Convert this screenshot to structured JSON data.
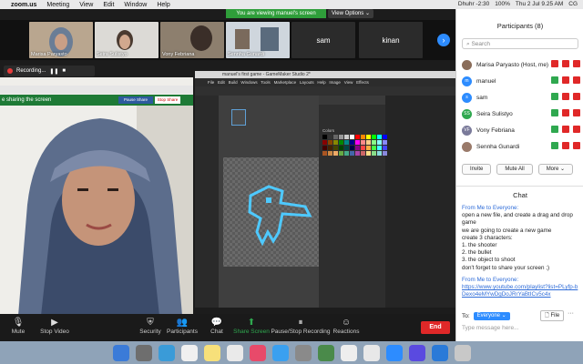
{
  "menubar": {
    "app": "zoom.us",
    "items": [
      "Meeting",
      "View",
      "Edit",
      "Window",
      "Help"
    ],
    "status": [
      "Dhuhr -2:30",
      "100%",
      "Thu 2 Jul 9.25 AM",
      "CG"
    ]
  },
  "meeting": {
    "viewing_banner": "You are viewing manuel's screen",
    "view_options": "View Options ⌄",
    "recording_label": "Recording...",
    "sharing_label": "e sharing the screen",
    "pause_share": "Pause Share",
    "stop_share": "Stop Share",
    "thumbnails": [
      {
        "name": "Marisa Paryasto",
        "kind": "video"
      },
      {
        "name": "Seira Sulistyo",
        "kind": "video"
      },
      {
        "name": "Vony Febriana",
        "kind": "video"
      },
      {
        "name": "Sennha Gunardi",
        "kind": "video"
      },
      {
        "name": "sam",
        "kind": "text"
      },
      {
        "name": "kinan",
        "kind": "text"
      }
    ],
    "toolbar": [
      {
        "label": "Mute",
        "icon": "microphone-icon"
      },
      {
        "label": "Stop Video",
        "icon": "video-camera-icon"
      },
      {
        "label": "Security",
        "icon": "shield-icon"
      },
      {
        "label": "Participants",
        "icon": "participants-icon",
        "badge": "8"
      },
      {
        "label": "Chat",
        "icon": "chat-icon"
      },
      {
        "label": "Share Screen",
        "icon": "share-screen-icon"
      },
      {
        "label": "Pause/Stop Recording",
        "icon": "pause-recording-icon"
      },
      {
        "label": "Reactions",
        "icon": "reactions-icon"
      }
    ],
    "end_button": "End"
  },
  "editor": {
    "title": "manuel's first game - GameMaker Studio 2*",
    "menu": [
      "File",
      "Edit",
      "Build",
      "Windows",
      "Tools",
      "Marketplace",
      "Layouts",
      "Help",
      "Image",
      "View",
      "Effects"
    ],
    "colors_label": "Colors"
  },
  "participants": {
    "title": "Participants (8)",
    "search_placeholder": "Search",
    "list": [
      {
        "name": "Marisa Paryasto (Host, me)",
        "initials": "",
        "color": "#8a6d5a",
        "mic_color": "#e02828"
      },
      {
        "name": "manuel",
        "initials": "m",
        "color": "#2d8cff",
        "mic_color": "#2fa84f"
      },
      {
        "name": "sam",
        "initials": "s",
        "color": "#2d8cff",
        "mic_color": "#2fa84f"
      },
      {
        "name": "Seira Sulistyo",
        "initials": "SS",
        "color": "#2fa84f",
        "mic_color": "#2fa84f"
      },
      {
        "name": "Vony Febriana",
        "initials": "VF",
        "color": "#7a7a9a",
        "mic_color": "#2fa84f"
      },
      {
        "name": "Sennha Gunardi",
        "initials": "",
        "color": "#9a7a6a",
        "mic_color": "#2fa84f"
      }
    ],
    "invite": "Invite",
    "mute_all": "Mute All",
    "more": "More ⌄"
  },
  "chat": {
    "title": "Chat",
    "messages": [
      {
        "from": "From Me to Everyone:",
        "lines": [
          "open a new file, and create a drag and drop game",
          "we are going to create a new game",
          "create 3 characters:",
          "1. the shooter",
          "2. the bullet",
          "3. the object to shoot",
          "don't forget to share your screen ;)"
        ]
      },
      {
        "from": "From Me to Everyone:",
        "link": "https://www.youtube.com/playlist?list=PLyfp-bDexo4eMYwDgDoJRrYaBtICv5c4x"
      }
    ],
    "to_label": "To:",
    "to_value": "Everyone ⌄",
    "file_button": "File",
    "placeholder": "Type message here..."
  },
  "colors": {
    "zoom_blue": "#2d8cff",
    "end_red": "#e02828",
    "share_green": "#2fa84f"
  }
}
